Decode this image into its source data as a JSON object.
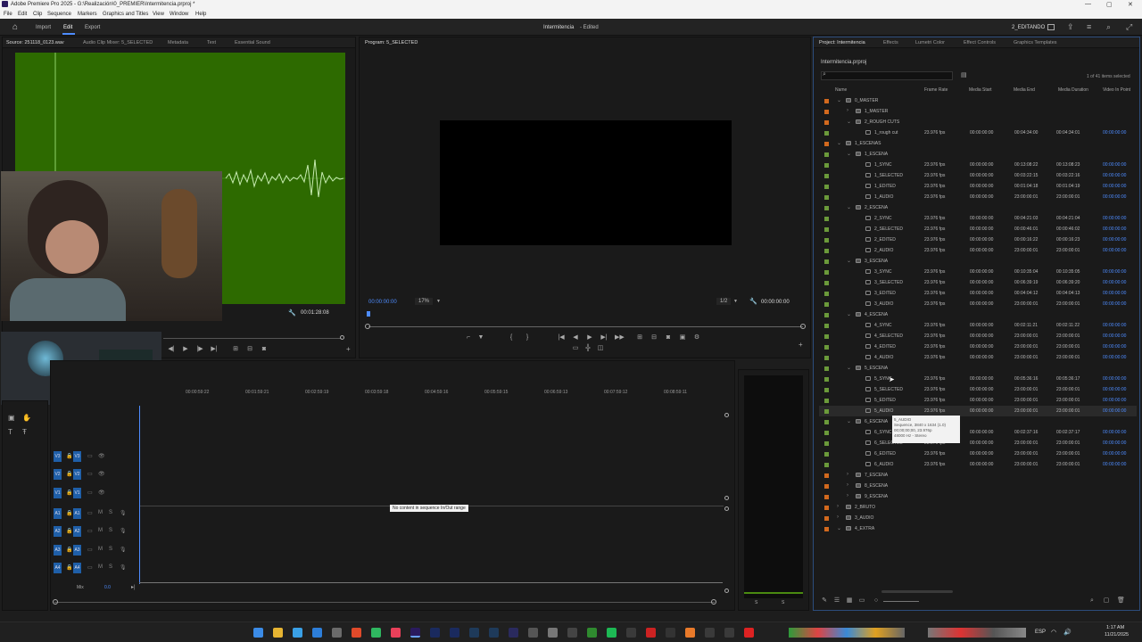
{
  "titlebar": {
    "title": "Adobe Premiere Pro 2025 - G:\\Realización\\0_PREMIER\\Intermitencia.prproj *",
    "minimize": "—",
    "maximize": "▢",
    "close": "✕"
  },
  "menu": [
    "File",
    "Edit",
    "Clip",
    "Sequence",
    "Markers",
    "Graphics and Titles",
    "View",
    "Window",
    "Help"
  ],
  "workspace": {
    "home": "⌂",
    "import": "Import",
    "edit": "Edit",
    "export": "Export",
    "center_title": "Intermitencia",
    "center_status": "- Edited",
    "workspace_name": "2_EDITANDO"
  },
  "source_panel": {
    "tabs": [
      "Source: 251118_0123.wav",
      "Audio Clip Mixer: 5_SELECTED",
      "Metadata",
      "Text",
      "Essential Sound"
    ],
    "timecode": "00:01:28:08"
  },
  "program_panel": {
    "tab": "Program: 5_SELECTED",
    "timecode_left": "00:00:00:00",
    "zoom": "17%",
    "resolution": "1/2",
    "timecode_right": "00:00:00:00"
  },
  "timeline": {
    "ruler": [
      "00:00:59:22",
      "00:01:59:21",
      "00:02:59:19",
      "00:03:59:18",
      "00:04:59:16",
      "00:05:59:15",
      "00:06:59:13",
      "00:07:59:12",
      "00:08:59:11"
    ],
    "video_tracks": [
      "V3",
      "V2",
      "V1"
    ],
    "audio_tracks": [
      "A1",
      "A2",
      "A3",
      "A4"
    ],
    "mix_label": "Mix",
    "mix_value": "0.0",
    "notice": "No content in sequence In/Out range"
  },
  "project_panel": {
    "tabs": [
      "Project: Intermitencia",
      "Effects",
      "Lumetri Color",
      "Effect Controls",
      "Graphics Templates"
    ],
    "path": "Intermitencia.prproj",
    "selection": "1 of 41 items selected",
    "columns": [
      "Name",
      "Frame Rate",
      "Media Start",
      "Media End",
      "Media Duration",
      "Video In Point"
    ],
    "rows": [
      {
        "indent": 0,
        "type": "bin",
        "open": true,
        "name": "0_MASTER",
        "color": "#d2691e"
      },
      {
        "indent": 1,
        "type": "bin",
        "open": false,
        "name": "1_MASTER",
        "color": "#d2691e"
      },
      {
        "indent": 1,
        "type": "bin",
        "open": true,
        "name": "2_ROUGH CUTS",
        "color": "#d2691e"
      },
      {
        "indent": 2,
        "type": "seq",
        "name": "1_rough cut",
        "color": "#6b9a3a",
        "fr": "23.976 fps",
        "ms": "00:00:00:00",
        "me": "00:04:34:00",
        "md": "00:04:34:01",
        "vi": "00:00:00:00"
      },
      {
        "indent": 0,
        "type": "bin",
        "open": true,
        "name": "1_ESCENAS",
        "color": "#d2691e"
      },
      {
        "indent": 1,
        "type": "bin",
        "open": true,
        "name": "1_ESCENA",
        "color": "#6b9a3a"
      },
      {
        "indent": 2,
        "type": "seq",
        "name": "1_SYNC",
        "color": "#6b9a3a",
        "fr": "23.976 fps",
        "ms": "00:00:00:00",
        "me": "00:13:08:22",
        "md": "00:13:08:23",
        "vi": "00:00:00:00"
      },
      {
        "indent": 2,
        "type": "seq",
        "name": "1_SELECTED",
        "color": "#6b9a3a",
        "fr": "23.976 fps",
        "ms": "00:00:00:00",
        "me": "00:03:22:15",
        "md": "00:03:22:16",
        "vi": "00:00:00:00"
      },
      {
        "indent": 2,
        "type": "seq",
        "name": "1_EDITED",
        "color": "#6b9a3a",
        "fr": "23.976 fps",
        "ms": "00:00:00:00",
        "me": "00:01:04:18",
        "md": "00:01:04:19",
        "vi": "00:00:00:00"
      },
      {
        "indent": 2,
        "type": "seq",
        "name": "1_AUDIO",
        "color": "#6b9a3a",
        "fr": "23.976 fps",
        "ms": "00:00:00:00",
        "me": "23:00:00:01",
        "md": "23:00:00:01",
        "vi": "00:00:00:00"
      },
      {
        "indent": 1,
        "type": "bin",
        "open": true,
        "name": "2_ESCENA",
        "color": "#6b9a3a"
      },
      {
        "indent": 2,
        "type": "seq",
        "name": "2_SYNC",
        "color": "#6b9a3a",
        "fr": "23.976 fps",
        "ms": "00:00:00:00",
        "me": "00:04:21:03",
        "md": "00:04:21:04",
        "vi": "00:00:00:00"
      },
      {
        "indent": 2,
        "type": "seq",
        "name": "2_SELECTED",
        "color": "#6b9a3a",
        "fr": "23.976 fps",
        "ms": "00:00:00:00",
        "me": "00:00:46:01",
        "md": "00:00:46:02",
        "vi": "00:00:00:00"
      },
      {
        "indent": 2,
        "type": "seq",
        "name": "2_EDITED",
        "color": "#6b9a3a",
        "fr": "23.976 fps",
        "ms": "00:00:00:00",
        "me": "00:00:16:22",
        "md": "00:00:16:23",
        "vi": "00:00:00:00"
      },
      {
        "indent": 2,
        "type": "seq",
        "name": "2_AUDIO",
        "color": "#6b9a3a",
        "fr": "23.976 fps",
        "ms": "00:00:00:00",
        "me": "23:00:00:01",
        "md": "23:00:00:01",
        "vi": "00:00:00:00"
      },
      {
        "indent": 1,
        "type": "bin",
        "open": true,
        "name": "3_ESCENA",
        "color": "#6b9a3a"
      },
      {
        "indent": 2,
        "type": "seq",
        "name": "3_SYNC",
        "color": "#6b9a3a",
        "fr": "23.976 fps",
        "ms": "00:00:00:00",
        "me": "00:10:35:04",
        "md": "00:10:35:05",
        "vi": "00:00:00:00"
      },
      {
        "indent": 2,
        "type": "seq",
        "name": "3_SELECTED",
        "color": "#6b9a3a",
        "fr": "23.976 fps",
        "ms": "00:00:00:00",
        "me": "00:06:39:19",
        "md": "00:06:39:20",
        "vi": "00:00:00:00"
      },
      {
        "indent": 2,
        "type": "seq",
        "name": "3_EDITED",
        "color": "#6b9a3a",
        "fr": "23.976 fps",
        "ms": "00:00:00:00",
        "me": "00:04:04:12",
        "md": "00:04:04:13",
        "vi": "00:00:00:00"
      },
      {
        "indent": 2,
        "type": "seq",
        "name": "3_AUDIO",
        "color": "#6b9a3a",
        "fr": "23.976 fps",
        "ms": "00:00:00:00",
        "me": "23:00:00:01",
        "md": "23:00:00:01",
        "vi": "00:00:00:00"
      },
      {
        "indent": 1,
        "type": "bin",
        "open": true,
        "name": "4_ESCENA",
        "color": "#6b9a3a"
      },
      {
        "indent": 2,
        "type": "seq",
        "name": "4_SYNC",
        "color": "#6b9a3a",
        "fr": "23.976 fps",
        "ms": "00:00:00:00",
        "me": "00:02:11:21",
        "md": "00:02:11:22",
        "vi": "00:00:00:00"
      },
      {
        "indent": 2,
        "type": "seq",
        "name": "4_SELECTED",
        "color": "#6b9a3a",
        "fr": "23.976 fps",
        "ms": "00:00:00:00",
        "me": "23:00:00:01",
        "md": "23:00:00:01",
        "vi": "00:00:00:00"
      },
      {
        "indent": 2,
        "type": "seq",
        "name": "4_EDITED",
        "color": "#6b9a3a",
        "fr": "23.976 fps",
        "ms": "00:00:00:00",
        "me": "23:00:00:01",
        "md": "23:00:00:01",
        "vi": "00:00:00:00"
      },
      {
        "indent": 2,
        "type": "seq",
        "name": "4_AUDIO",
        "color": "#6b9a3a",
        "fr": "23.976 fps",
        "ms": "00:00:00:00",
        "me": "23:00:00:01",
        "md": "23:00:00:01",
        "vi": "00:00:00:00"
      },
      {
        "indent": 1,
        "type": "bin",
        "open": true,
        "name": "5_ESCENA",
        "color": "#6b9a3a"
      },
      {
        "indent": 2,
        "type": "seq",
        "name": "5_SYNC",
        "color": "#6b9a3a",
        "fr": "23.976 fps",
        "ms": "00:00:00:00",
        "me": "00:05:36:16",
        "md": "00:05:36:17",
        "vi": "00:00:00:00"
      },
      {
        "indent": 2,
        "type": "seq",
        "name": "5_SELECTED",
        "color": "#6b9a3a",
        "fr": "23.976 fps",
        "ms": "00:00:00:00",
        "me": "23:00:00:01",
        "md": "23:00:00:01",
        "vi": "00:00:00:00"
      },
      {
        "indent": 2,
        "type": "seq",
        "name": "5_EDITED",
        "color": "#6b9a3a",
        "fr": "23.976 fps",
        "ms": "00:00:00:00",
        "me": "23:00:00:01",
        "md": "23:00:00:01",
        "vi": "00:00:00:00"
      },
      {
        "indent": 2,
        "type": "seq",
        "name": "5_AUDIO",
        "color": "#6b9a3a",
        "fr": "23.976 fps",
        "ms": "00:00:00:00",
        "me": "23:00:00:01",
        "md": "23:00:00:01",
        "vi": "00:00:00:00",
        "selected": true
      },
      {
        "indent": 1,
        "type": "bin",
        "open": true,
        "name": "6_ESCENA",
        "color": "#6b9a3a"
      },
      {
        "indent": 2,
        "type": "seq",
        "name": "6_SYNC",
        "color": "#6b9a3a",
        "fr": "23.976 fps",
        "ms": "00:00:00:00",
        "me": "00:02:37:16",
        "md": "00:02:37:17",
        "vi": "00:00:00:00"
      },
      {
        "indent": 2,
        "type": "seq",
        "name": "6_SELECTED",
        "color": "#6b9a3a",
        "fr": "23.976 fps",
        "ms": "00:00:00:00",
        "me": "23:00:00:01",
        "md": "23:00:00:01",
        "vi": "00:00:00:00"
      },
      {
        "indent": 2,
        "type": "seq",
        "name": "6_EDITED",
        "color": "#6b9a3a",
        "fr": "23.976 fps",
        "ms": "00:00:00:00",
        "me": "23:00:00:01",
        "md": "23:00:00:01",
        "vi": "00:00:00:00"
      },
      {
        "indent": 2,
        "type": "seq",
        "name": "6_AUDIO",
        "color": "#6b9a3a",
        "fr": "23.976 fps",
        "ms": "00:00:00:00",
        "me": "23:00:00:01",
        "md": "23:00:00:01",
        "vi": "00:00:00:00"
      },
      {
        "indent": 1,
        "type": "bin",
        "open": false,
        "name": "7_ESCENA",
        "color": "#d2691e"
      },
      {
        "indent": 1,
        "type": "bin",
        "open": false,
        "name": "8_ESCENA",
        "color": "#d2691e"
      },
      {
        "indent": 1,
        "type": "bin",
        "open": false,
        "name": "9_ESCENA",
        "color": "#d2691e"
      },
      {
        "indent": 0,
        "type": "bin",
        "open": false,
        "name": "2_BRUTO",
        "color": "#d2691e"
      },
      {
        "indent": 0,
        "type": "bin",
        "open": false,
        "name": "3_AUDIO",
        "color": "#d2691e"
      },
      {
        "indent": 0,
        "type": "bin",
        "open": true,
        "name": "4_EXTRA",
        "color": "#d2691e"
      }
    ],
    "tooltip": [
      "5_AUDIO",
      "Sequence, 3840 x 1634 (1.0)",
      "00;00;00;00, 23.976p",
      "48000 Hz - Stereo"
    ]
  },
  "taskbar": {
    "lang": "ESP",
    "time": "1:17 AM",
    "date": "11/21/2025"
  }
}
